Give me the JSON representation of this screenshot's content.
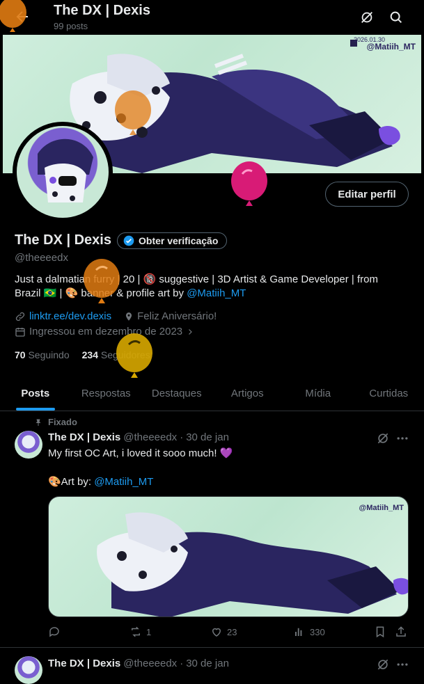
{
  "header": {
    "title": "The DX | Dexis",
    "posts_count": "99 posts"
  },
  "banner": {
    "signature": "@Matiih_MT",
    "date_stamp": "2026.01.30"
  },
  "profile": {
    "edit_label": "Editar perfil",
    "display_name": "The DX | Dexis",
    "verify_label": "Obter verificação",
    "handle": "@theeeedx",
    "bio_line1": "Just a dalmatian furry | 20 | 🔞 suggestive | 3D Artist & Game Developer | from",
    "bio_line2_pre": "Brazil 🇧🇷 | 🎨 banner & profile art by ",
    "bio_mention": "@Matiih_MT",
    "link": "linktr.ee/dev.dexis",
    "birthday": "Feliz Aniversário!",
    "joined": "Ingressou em dezembro de 2023",
    "following_count": "70",
    "following_label": "Seguindo",
    "followers_count": "234",
    "followers_label": "Seguidores"
  },
  "tabs": [
    {
      "label": "Posts",
      "active": true
    },
    {
      "label": "Respostas",
      "active": false
    },
    {
      "label": "Destaques",
      "active": false
    },
    {
      "label": "Artigos",
      "active": false
    },
    {
      "label": "Mídia",
      "active": false
    },
    {
      "label": "Curtidas",
      "active": false
    }
  ],
  "tweet1": {
    "pinned_label": "Fixado",
    "name": "The DX | Dexis",
    "handle": "@theeeedx",
    "dot": "·",
    "date": "30 de jan",
    "text": "My first OC Art, i loved it sooo much! 💜",
    "art_prefix": "🎨Art by: ",
    "art_mention": "@Matiih_MT",
    "replies": "",
    "reposts": "1",
    "likes": "23",
    "views": "330"
  },
  "tweet2": {
    "name": "The DX | Dexis",
    "handle": "@theeeedx",
    "dot": "·",
    "date": "30 de jan"
  },
  "colors": {
    "accent": "#1d9bf0",
    "muted": "#71767b",
    "border": "#2f3336",
    "balloon_orange": "#e07b12",
    "balloon_pink": "#d81b76",
    "balloon_yellow": "#d8a800"
  }
}
